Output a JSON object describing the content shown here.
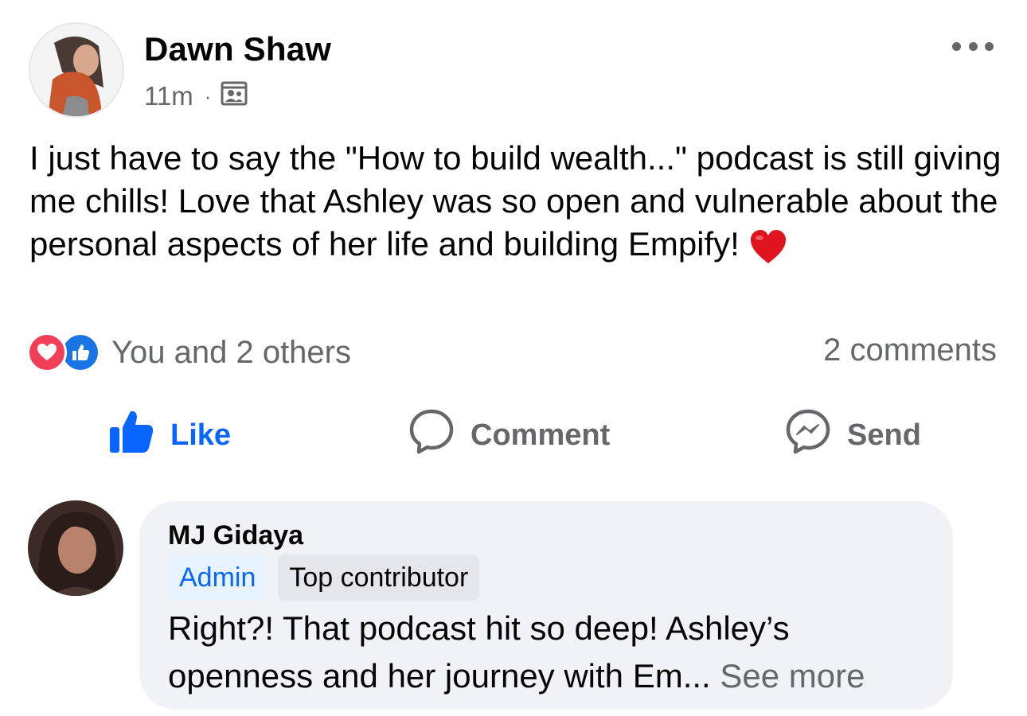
{
  "post": {
    "author": "Dawn Shaw",
    "time": "11m",
    "separator": "·",
    "audience_icon": "group-members-icon",
    "more_icon": "more-options-icon",
    "text": "I just have to say the \"How to build wealth...\" podcast is still giving me chills! Love that Ashley was so open and vulnerable about the personal aspects of her life and building Empify!",
    "emoji": "heart-emoji"
  },
  "reactions": {
    "icons": [
      "love-reaction-icon",
      "like-reaction-icon"
    ],
    "text": "You and 2 others",
    "comments_count": "2 comments"
  },
  "actions": {
    "like": "Like",
    "comment": "Comment",
    "send": "Send"
  },
  "comment": {
    "author": "MJ Gidaya",
    "badges": [
      "Admin",
      "Top contributor"
    ],
    "text": "Right?! That podcast hit so deep! Ashley’s openness and her journey with Em...",
    "see_more": "See more"
  },
  "colors": {
    "accent_blue": "#0866ff",
    "love_red": "#f33e58",
    "secondary_text": "#65676b",
    "bubble_bg": "#f0f2f5"
  }
}
